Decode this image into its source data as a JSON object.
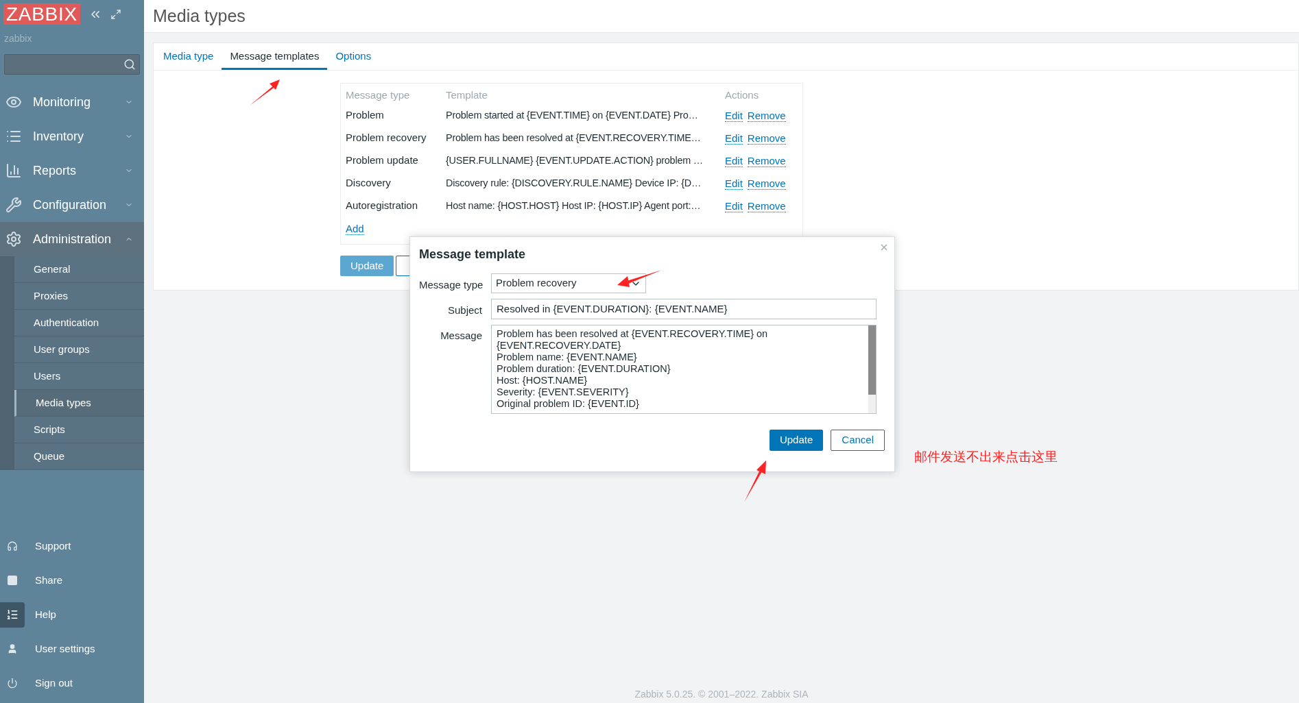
{
  "sidebar": {
    "logo": "ZABBIX",
    "user": "zabbix",
    "menu": [
      {
        "label": "Monitoring",
        "expanded": false
      },
      {
        "label": "Inventory",
        "expanded": false
      },
      {
        "label": "Reports",
        "expanded": false
      },
      {
        "label": "Configuration",
        "expanded": false
      },
      {
        "label": "Administration",
        "expanded": true,
        "children": [
          {
            "label": "General",
            "selected": false
          },
          {
            "label": "Proxies",
            "selected": false
          },
          {
            "label": "Authentication",
            "selected": false
          },
          {
            "label": "User groups",
            "selected": false
          },
          {
            "label": "Users",
            "selected": false
          },
          {
            "label": "Media types",
            "selected": true
          },
          {
            "label": "Scripts",
            "selected": false
          },
          {
            "label": "Queue",
            "selected": false
          }
        ]
      }
    ],
    "bottom_menu": [
      {
        "label": "Support"
      },
      {
        "label": "Share"
      },
      {
        "label": "Help"
      },
      {
        "label": "User settings"
      },
      {
        "label": "Sign out"
      }
    ]
  },
  "page_title": "Media types",
  "tabs": [
    {
      "label": "Media type",
      "selected": false
    },
    {
      "label": "Message templates",
      "selected": true
    },
    {
      "label": "Options",
      "selected": false
    }
  ],
  "table": {
    "columns": [
      "Message type",
      "Template",
      "Actions"
    ],
    "rows": [
      {
        "message_type": "Problem",
        "template": "Problem started at {EVENT.TIME} on {EVENT.DATE} Pro…",
        "actions": [
          "Edit",
          "Remove"
        ]
      },
      {
        "message_type": "Problem recovery",
        "template": "Problem has been resolved at {EVENT.RECOVERY.TIME…",
        "actions": [
          "Edit",
          "Remove"
        ]
      },
      {
        "message_type": "Problem update",
        "template": "{USER.FULLNAME} {EVENT.UPDATE.ACTION} problem …",
        "actions": [
          "Edit",
          "Remove"
        ]
      },
      {
        "message_type": "Discovery",
        "template": "Discovery rule: {DISCOVERY.RULE.NAME} Device IP: {D…",
        "actions": [
          "Edit",
          "Remove"
        ]
      },
      {
        "message_type": "Autoregistration",
        "template": "Host name: {HOST.HOST} Host IP: {HOST.IP} Agent port:…",
        "actions": [
          "Edit",
          "Remove"
        ]
      }
    ],
    "add_link": "Add"
  },
  "form_buttons": [
    "Update"
  ],
  "dialog": {
    "title": "Message template",
    "fields": [
      {
        "label": "Message type",
        "kind": "select",
        "value": "Problem recovery"
      },
      {
        "label": "Subject",
        "kind": "input",
        "value": "Resolved in {EVENT.DURATION}: {EVENT.NAME}"
      },
      {
        "label": "Message",
        "kind": "textarea",
        "lines": [
          "Problem has been resolved at {EVENT.RECOVERY.TIME} on",
          "{EVENT.RECOVERY.DATE}",
          "Problem name: {EVENT.NAME}",
          "Problem duration: {EVENT.DURATION}",
          "Host: {HOST.NAME}",
          "Severity: {EVENT.SEVERITY}",
          "Original problem ID: {EVENT.ID}"
        ]
      }
    ],
    "buttons": [
      {
        "label": "Update",
        "kind": "primary"
      },
      {
        "label": "Cancel",
        "kind": "secondary"
      }
    ]
  },
  "annotation": "邮件发送不出来点击这里",
  "footer": "Zabbix 5.0.25. © 2001–2022. Zabbix SIA"
}
